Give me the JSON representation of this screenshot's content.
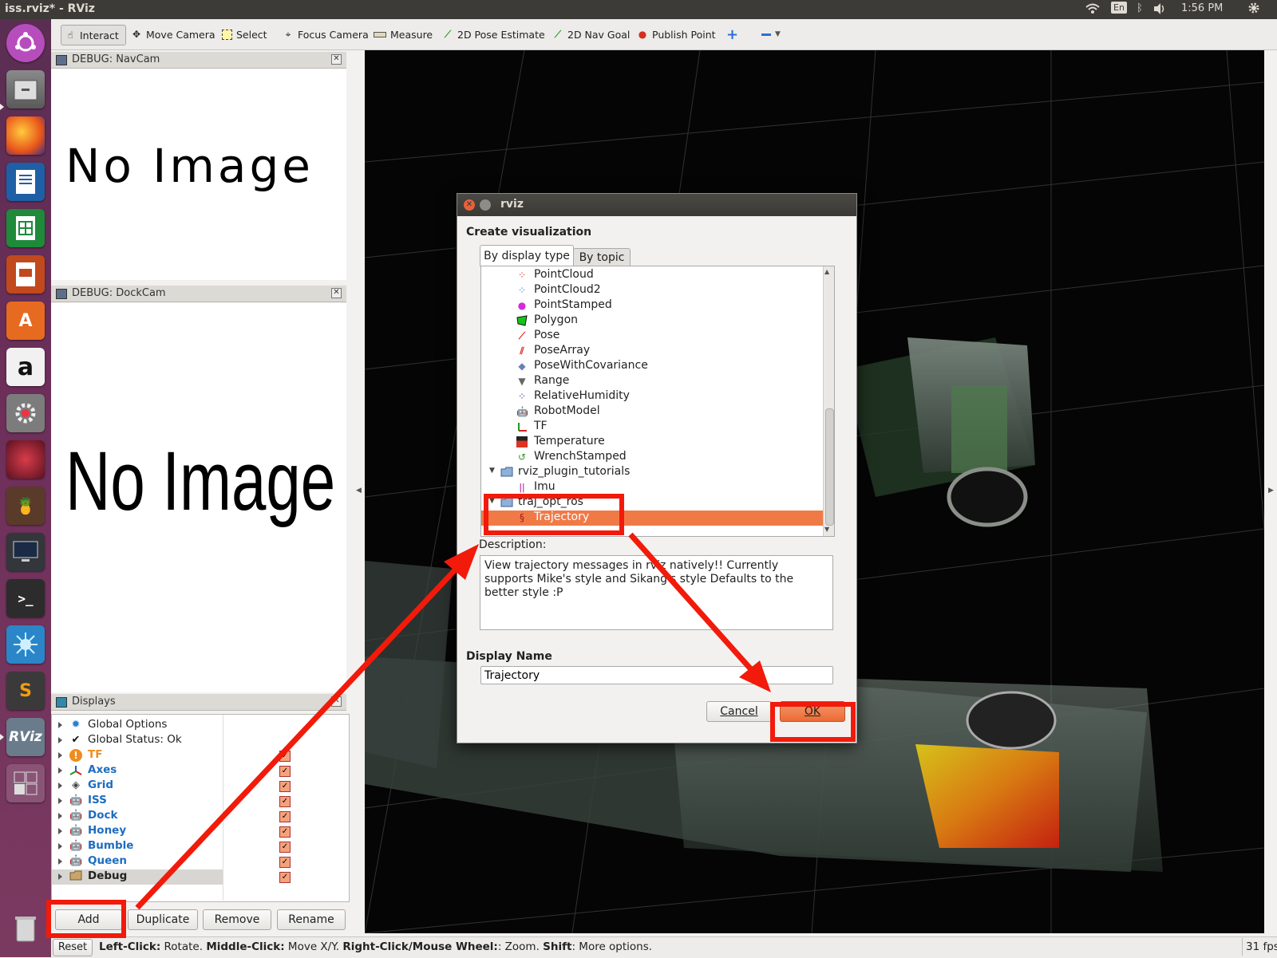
{
  "window": {
    "title": "iss.rviz* - RViz"
  },
  "tray": {
    "keyboard": "En",
    "time": "1:56 PM"
  },
  "toolbar": {
    "tools": [
      {
        "label": "Interact",
        "icon": "hand-pointer-icon"
      },
      {
        "label": "Move Camera",
        "icon": "move-camera-icon"
      },
      {
        "label": "Select",
        "icon": "select-rect-icon"
      },
      {
        "label": "Focus Camera",
        "icon": "focus-target-icon"
      },
      {
        "label": "Measure",
        "icon": "ruler-icon"
      },
      {
        "label": "2D Pose Estimate",
        "icon": "green-arrow-icon"
      },
      {
        "label": "2D Nav Goal",
        "icon": "green-arrow-icon"
      },
      {
        "label": "Publish Point",
        "icon": "map-pin-icon"
      }
    ]
  },
  "panels": {
    "navcam": {
      "title": "DEBUG: NavCam",
      "content": "No Image"
    },
    "dockcam": {
      "title": "DEBUG: DockCam",
      "content": "No Image"
    },
    "displays": {
      "title": "Displays",
      "items": [
        {
          "label": "Global Options",
          "icon": "gear-icon",
          "style": "normal",
          "checked": null
        },
        {
          "label": "Global Status: Ok",
          "icon": "checkmark-icon",
          "style": "normal",
          "checked": null
        },
        {
          "label": "TF",
          "icon": "warning-icon",
          "style": "orange",
          "checked": true
        },
        {
          "label": "Axes",
          "icon": "axes-icon",
          "style": "blue",
          "checked": true
        },
        {
          "label": "Grid",
          "icon": "grid-icon",
          "style": "blue",
          "checked": true
        },
        {
          "label": "ISS",
          "icon": "robot-model-icon",
          "style": "blue",
          "checked": true
        },
        {
          "label": "Dock",
          "icon": "robot-model-icon",
          "style": "blue",
          "checked": true
        },
        {
          "label": "Honey",
          "icon": "robot-model-icon",
          "style": "blue",
          "checked": true
        },
        {
          "label": "Bumble",
          "icon": "robot-model-icon",
          "style": "blue",
          "checked": true
        },
        {
          "label": "Queen",
          "icon": "robot-model-icon",
          "style": "blue",
          "checked": true
        },
        {
          "label": "Debug",
          "icon": "folder-icon",
          "style": "bold",
          "checked": true
        }
      ],
      "buttons": {
        "add": "Add",
        "duplicate": "Duplicate",
        "remove": "Remove",
        "rename": "Rename"
      }
    }
  },
  "status": {
    "reset": "Reset",
    "hint": [
      {
        "b": "Left-Click:",
        "t": " Rotate. "
      },
      {
        "b": "Middle-Click:",
        "t": " Move X/Y. "
      },
      {
        "b": "Right-Click/Mouse Wheel:",
        "t": ": Zoom. "
      },
      {
        "b": "Shift",
        "t": ": More options."
      }
    ],
    "fps": "31 fps"
  },
  "dialog": {
    "title": "rviz",
    "heading": "Create visualization",
    "tabs": [
      "By display type",
      "By topic"
    ],
    "tree": [
      {
        "label": "PointCloud",
        "icon": "pointcloud-icon",
        "indent": 2
      },
      {
        "label": "PointCloud2",
        "icon": "pointcloud2-icon",
        "indent": 2
      },
      {
        "label": "PointStamped",
        "icon": "magenta-dot-icon",
        "indent": 2
      },
      {
        "label": "Polygon",
        "icon": "polygon-icon",
        "indent": 2
      },
      {
        "label": "Pose",
        "icon": "pose-arrow-icon",
        "indent": 2
      },
      {
        "label": "PoseArray",
        "icon": "pose-array-icon",
        "indent": 2
      },
      {
        "label": "PoseWithCovariance",
        "icon": "diamond-icon",
        "indent": 2
      },
      {
        "label": "Range",
        "icon": "range-cone-icon",
        "indent": 2
      },
      {
        "label": "RelativeHumidity",
        "icon": "humidity-icon",
        "indent": 2
      },
      {
        "label": "RobotModel",
        "icon": "robot-model-icon",
        "indent": 2
      },
      {
        "label": "TF",
        "icon": "tf-axes-icon",
        "indent": 2
      },
      {
        "label": "Temperature",
        "icon": "thermometer-icon",
        "indent": 2
      },
      {
        "label": "WrenchStamped",
        "icon": "wrench-icon",
        "indent": 2
      },
      {
        "label": "rviz_plugin_tutorials",
        "icon": "folder-icon",
        "indent": 1
      },
      {
        "label": "Imu",
        "icon": "imu-icon",
        "indent": 2
      },
      {
        "label": "traj_opt_ros",
        "icon": "folder-icon",
        "indent": 1
      },
      {
        "label": "Trajectory",
        "icon": "trajectory-icon",
        "indent": 2,
        "selected": true
      }
    ],
    "description_label": "Description:",
    "description": "View trajectory messages in rviz natively!! Currently supports Mike's style and Sikang's style Defaults to the better style :P",
    "display_name_label": "Display Name",
    "display_name_value": "Trajectory",
    "cancel": "Cancel",
    "ok": "OK"
  },
  "colors": {
    "selection": "#f07a46",
    "annotation": "#f21a0a",
    "launcher": "#6d2f5a"
  }
}
